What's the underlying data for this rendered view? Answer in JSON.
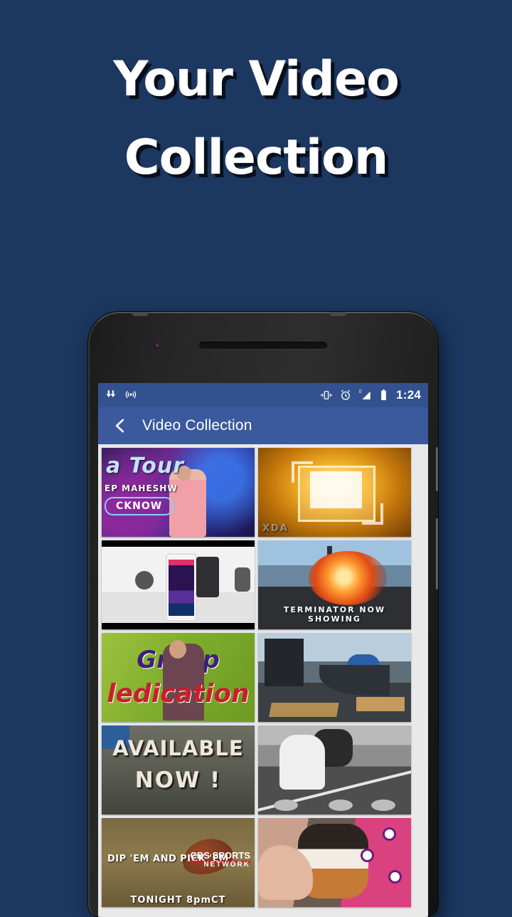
{
  "promo": {
    "headline_line1": "Your Video",
    "headline_line2": "Collection",
    "background_color": "#1c3760",
    "text_color": "#ffffff"
  },
  "device": {
    "name": "android-phone-mockup",
    "body_color": "#262626"
  },
  "statusbar": {
    "background_color": "#33518f",
    "time": "1:24",
    "left_icons": [
      "download-icon",
      "hotspot-icon"
    ],
    "right_icons": [
      "vibrate-icon",
      "alarm-icon",
      "edge-signal-icon",
      "battery-icon"
    ],
    "network_label": "E"
  },
  "appbar": {
    "background_color": "#3b5a9e",
    "back_label": "Back",
    "title": "Video Collection"
  },
  "gallery": {
    "background_color": "#e9e9e9",
    "columns": 2,
    "items": [
      {
        "id": "thumb-1",
        "caption_title": "a Tour",
        "caption_sub": "EP MAHESHW",
        "caption_pill": "CKNOW",
        "scene": "stage-speaker-purple"
      },
      {
        "id": "thumb-2",
        "watermark": "XDA",
        "scene": "golden-tablet-screen"
      },
      {
        "id": "thumb-3",
        "scene": "smartphone-product-white"
      },
      {
        "id": "thumb-4",
        "caption": "TERMINATOR      NOW SHOWING",
        "scene": "explosion-town"
      },
      {
        "id": "thumb-5",
        "caption_word1": "Group",
        "caption_word2": "ledication",
        "scene": "green-meditation-talk"
      },
      {
        "id": "thumb-6",
        "scene": "skate-ramp-construction"
      },
      {
        "id": "thumb-7",
        "caption_line1": "AVAILABLE",
        "caption_line2": "NOW !",
        "scene": "car-promo"
      },
      {
        "id": "thumb-8",
        "scene": "vintage-bw-dock"
      },
      {
        "id": "thumb-9",
        "caption": "DIP 'EM AND PICK 'EM",
        "brand": "CBS SPORTS",
        "brand_sub": "NETWORK",
        "schedule": "TONIGHT 8pmCT",
        "scene": "football-grass"
      },
      {
        "id": "thumb-10",
        "scene": "puppy-pink-blanket"
      }
    ]
  }
}
